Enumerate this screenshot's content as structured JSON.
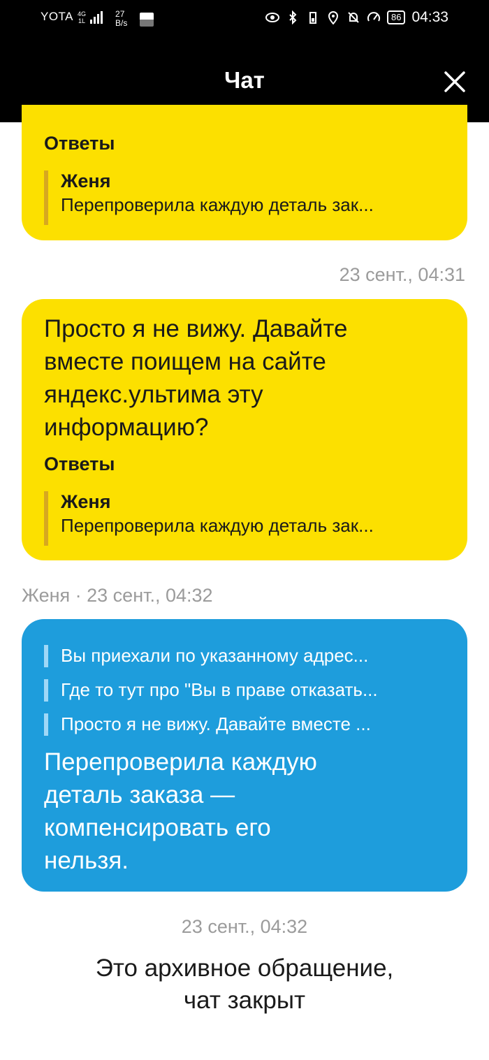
{
  "status_bar": {
    "carrier": "YOTA",
    "network": "4G",
    "network_sub": "1L",
    "speed_value": "27",
    "speed_unit": "B/s",
    "battery": "86",
    "time": "04:33",
    "icons": [
      "eye-icon",
      "bluetooth-icon",
      "battery-small-icon",
      "location-icon",
      "bell-off-icon",
      "speedometer-icon"
    ]
  },
  "header": {
    "title": "Чат",
    "close_icon": "close-icon"
  },
  "messages": [
    {
      "answers_label": "Ответы",
      "quote_author": "Женя",
      "quote_text": "Перепроверила каждую деталь зак..."
    },
    {
      "timestamp": "23 сент., 04:31",
      "text_lines": [
        "Просто я не вижу. Давайте",
        "вместе поищем на сайте",
        "яндекс.ультима эту",
        "информацию?"
      ],
      "answers_label": "Ответы",
      "quote_author": "Женя",
      "quote_text": "Перепроверила каждую деталь зак..."
    },
    {
      "meta": "Женя · 23 сент., 04:32",
      "quotes": [
        "Вы приехали по указанному адрес...",
        "Где то тут про \"Вы в праве отказать...",
        "Просто я не вижу. Давайте вместе ..."
      ],
      "text_lines": [
        "Перепроверила каждую",
        "деталь заказа —",
        "компенсировать его",
        "нельзя."
      ]
    }
  ],
  "footer": {
    "timestamp": "23 сент., 04:32",
    "archive_line1": "Это архивное обращение,",
    "archive_line2": "чат закрыт"
  },
  "colors": {
    "operator_bubble": "#fce000",
    "user_bubble": "#1e9ddc",
    "header_bg": "#000000"
  }
}
